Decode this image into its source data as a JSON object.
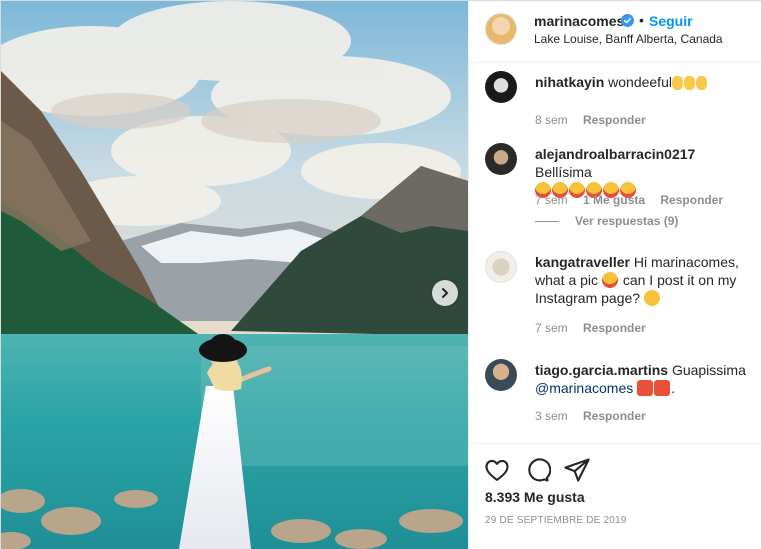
{
  "post": {
    "username": "marinacomes",
    "follow_label": "Seguir",
    "dot": "•",
    "location": "Lake Louise, Banff Alberta, Canada",
    "likes": "8.393 Me gusta",
    "date": "29 DE SEPTIEMBRE DE 2019"
  },
  "comments": [
    {
      "username": "nihatkayin",
      "text": "wondeeful",
      "emoji": [
        "ok-hand",
        "ok-hand",
        "ok-hand"
      ],
      "time": "8 sem",
      "reply_label": "Responder"
    },
    {
      "username": "alejandroalbarracin0217",
      "text": "Bellísima",
      "emoji": [
        "star-struck",
        "star-struck",
        "star-struck",
        "star-struck",
        "star-struck",
        "star-struck"
      ],
      "time": "7 sem",
      "likes_label": "1 Me gusta",
      "reply_label": "Responder",
      "view_replies": "Ver respuestas (9)"
    },
    {
      "username": "kangatraveller",
      "text_1": "Hi marinacomes,",
      "text_2": "what a pic",
      "text_3": "can I post it on my Instagram page?",
      "time": "7 sem",
      "reply_label": "Responder"
    },
    {
      "username": "tiago.garcia.martins",
      "text": "Guapissima",
      "mention": "@marinacomes",
      "suffix": ".",
      "time": "3 sem",
      "reply_label": "Responder"
    }
  ],
  "icons": {
    "like": "heart-icon",
    "comment": "comment-icon",
    "share": "paper-plane-icon",
    "next": "chevron-right-icon",
    "verified": "verified-badge-icon"
  },
  "colors": {
    "link_blue": "#0095f6",
    "verified_blue": "#3897f0",
    "muted": "#8e8e8e",
    "text": "#262626",
    "mention": "#00376b"
  }
}
